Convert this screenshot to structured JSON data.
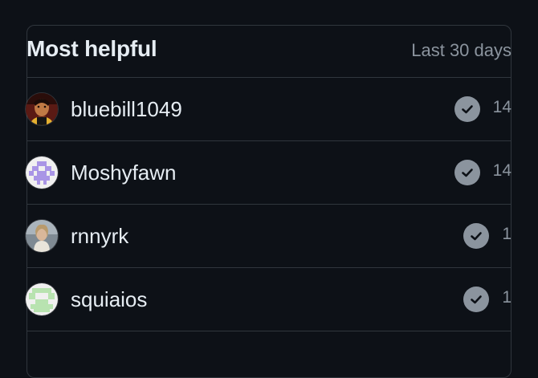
{
  "header": {
    "title": "Most helpful",
    "period": "Last 30 days"
  },
  "contributors": [
    {
      "username": "bluebill1049",
      "answers": "14",
      "avatar_icon": "photo-avatar-icon"
    },
    {
      "username": "Moshyfawn",
      "answers": "14",
      "avatar_icon": "identicon-purple-icon"
    },
    {
      "username": "rnnyrk",
      "answers": "1",
      "avatar_icon": "photo-avatar-icon"
    },
    {
      "username": "squiaios",
      "answers": "1",
      "avatar_icon": "identicon-green-icon"
    }
  ],
  "colors": {
    "background": "#0d1117",
    "border": "#30363d",
    "text_primary": "#e6edf3",
    "text_muted": "#8b949e",
    "identicon_purple": "#a995e6",
    "identicon_green": "#b8e3b0"
  }
}
